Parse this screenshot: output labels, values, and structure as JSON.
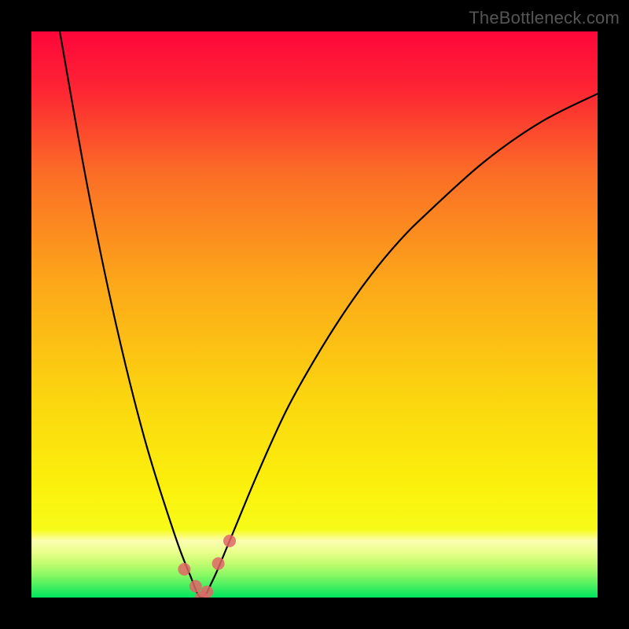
{
  "watermark": "TheBottleneck.com",
  "chart_data": {
    "type": "line",
    "title": "",
    "xlabel": "",
    "ylabel": "",
    "xlim": [
      0,
      100
    ],
    "ylim": [
      0,
      100
    ],
    "background_gradient": {
      "top_color": "#fe063a",
      "mid_color": "#fcf110",
      "bottom_color": "#00e65f",
      "note": "vertical gradient red→orange→yellow→green representing bottleneck severity; green at y≈0"
    },
    "series": [
      {
        "name": "bottleneck-curve",
        "note": "V-shaped curve; y is bottleneck % (lower = better). Minimum near x≈30.",
        "x": [
          5,
          10,
          15,
          20,
          25,
          28,
          30,
          32,
          35,
          40,
          45,
          50,
          55,
          60,
          65,
          70,
          80,
          90,
          100
        ],
        "values": [
          100,
          72,
          48,
          28,
          12,
          4,
          0,
          3,
          10,
          22,
          33,
          42,
          50,
          57,
          63,
          68,
          77,
          84,
          89
        ]
      }
    ],
    "markers": {
      "series": "bottleneck-curve",
      "note": "highlighted data points near the minimum",
      "points": [
        {
          "x": 27,
          "y": 5
        },
        {
          "x": 29,
          "y": 2
        },
        {
          "x": 30,
          "y": 0
        },
        {
          "x": 31,
          "y": 1
        },
        {
          "x": 33,
          "y": 6
        },
        {
          "x": 35,
          "y": 10
        }
      ]
    }
  }
}
